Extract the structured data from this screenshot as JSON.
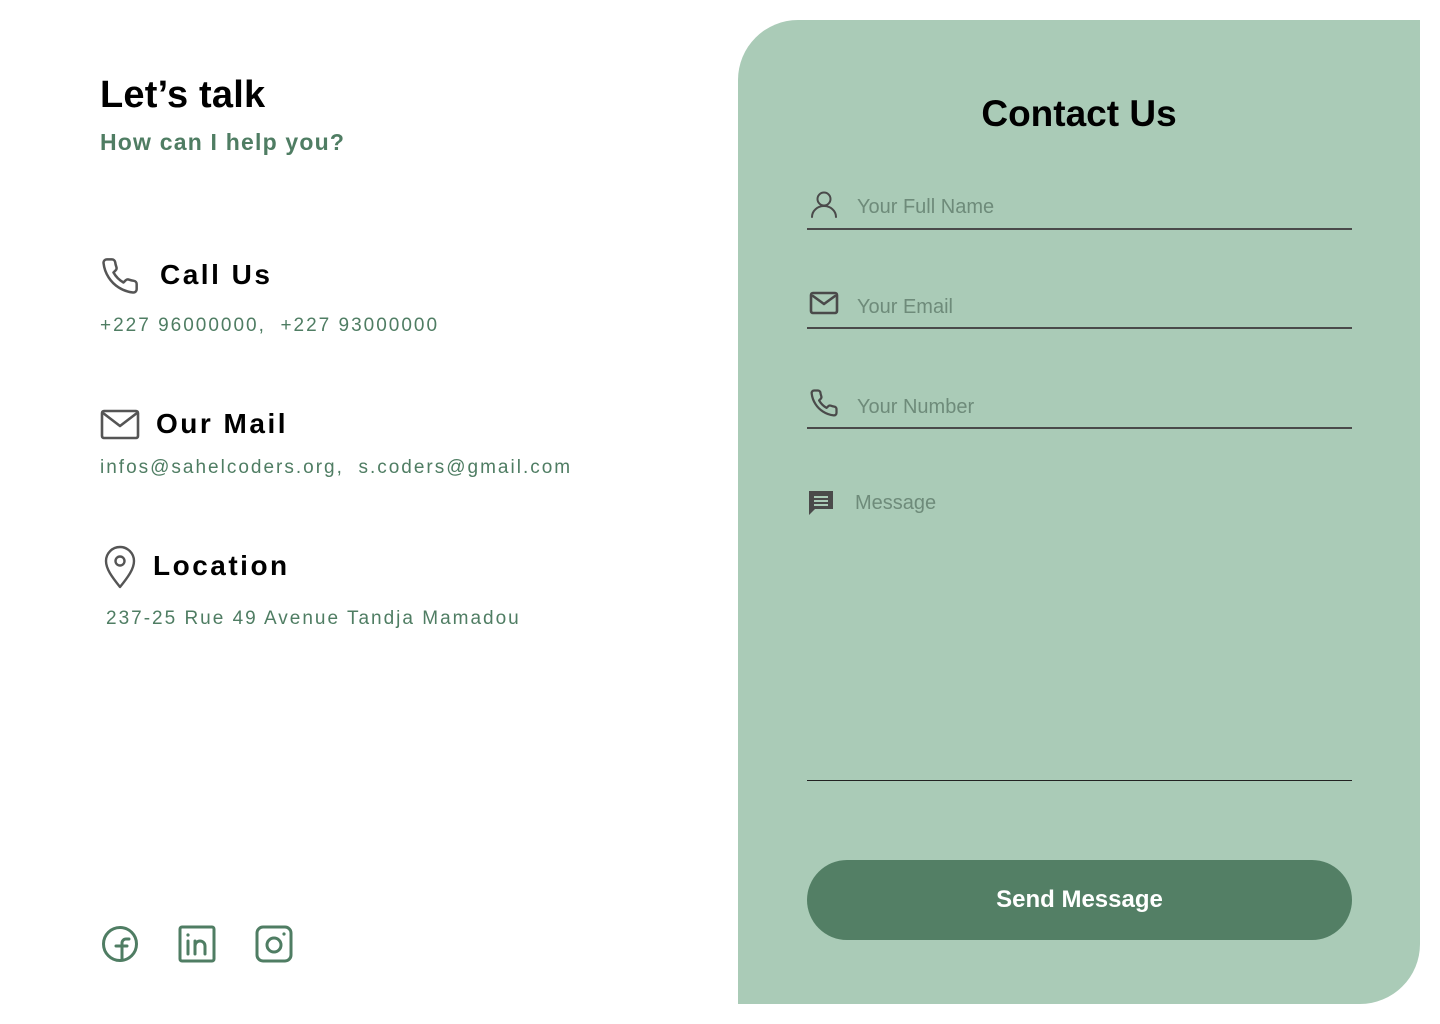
{
  "left": {
    "heading": "Let’s talk",
    "subheading": "How can I help you?",
    "call": {
      "title": "Call Us",
      "value": "+227 96000000,  +227 93000000",
      "icon": "phone-icon"
    },
    "mail": {
      "title": "Our Mail",
      "value": "infos@sahelcoders.org,  s.coders@gmail.com",
      "icon": "mail-icon"
    },
    "location": {
      "title": "Location",
      "value": "237-25 Rue 49 Avenue Tandja Mamadou",
      "icon": "location-pin-icon"
    },
    "social": [
      "facebook-icon",
      "linkedin-icon",
      "instagram-icon"
    ]
  },
  "form": {
    "title": "Contact Us",
    "name_placeholder": "Your Full Name",
    "email_placeholder": "Your Email",
    "number_placeholder": "Your Number",
    "message_placeholder": "Message",
    "send_label": "Send Message"
  },
  "colors": {
    "accent": "#537f65",
    "accent_text": "#4f7d63",
    "card_bg": "#aacbb7"
  }
}
